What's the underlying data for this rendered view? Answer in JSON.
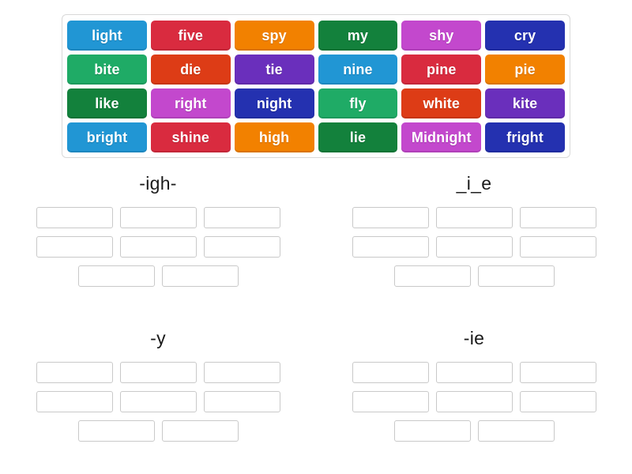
{
  "wordbank": {
    "name": "word-bank",
    "tiles": [
      {
        "label": "light",
        "color": "#2196d4"
      },
      {
        "label": "five",
        "color": "#d92b3f"
      },
      {
        "label": "spy",
        "color": "#f28100"
      },
      {
        "label": "my",
        "color": "#13813c"
      },
      {
        "label": "shy",
        "color": "#c348cd"
      },
      {
        "label": "cry",
        "color": "#2431b0"
      },
      {
        "label": "bite",
        "color": "#1fab66"
      },
      {
        "label": "die",
        "color": "#dd3c16"
      },
      {
        "label": "tie",
        "color": "#6a2fbc"
      },
      {
        "label": "nine",
        "color": "#2196d4"
      },
      {
        "label": "pine",
        "color": "#d92b3f"
      },
      {
        "label": "pie",
        "color": "#f28100"
      },
      {
        "label": "like",
        "color": "#13813c"
      },
      {
        "label": "right",
        "color": "#c348cd"
      },
      {
        "label": "night",
        "color": "#2431b0"
      },
      {
        "label": "fly",
        "color": "#1fab66"
      },
      {
        "label": "white",
        "color": "#dd3c16"
      },
      {
        "label": "kite",
        "color": "#6a2fbc"
      },
      {
        "label": "bright",
        "color": "#2196d4"
      },
      {
        "label": "shine",
        "color": "#d92b3f"
      },
      {
        "label": "high",
        "color": "#f28100"
      },
      {
        "label": "lie",
        "color": "#13813c"
      },
      {
        "label": "Midnight",
        "color": "#c348cd"
      },
      {
        "label": "fright",
        "color": "#2431b0"
      }
    ]
  },
  "groups": [
    {
      "title": "-igh-",
      "rows": [
        3,
        3,
        2
      ]
    },
    {
      "title": "_i_e",
      "rows": [
        3,
        3,
        2
      ]
    },
    {
      "title": "-y",
      "rows": [
        3,
        3,
        2
      ]
    },
    {
      "title": "-ie",
      "rows": [
        3,
        3,
        2
      ]
    }
  ],
  "style": {
    "slot_border_color": "#c9c9c9",
    "bank_border_color": "#d8d8d8",
    "page_background": "#ffffff",
    "title_color": "#1a1a1a"
  }
}
